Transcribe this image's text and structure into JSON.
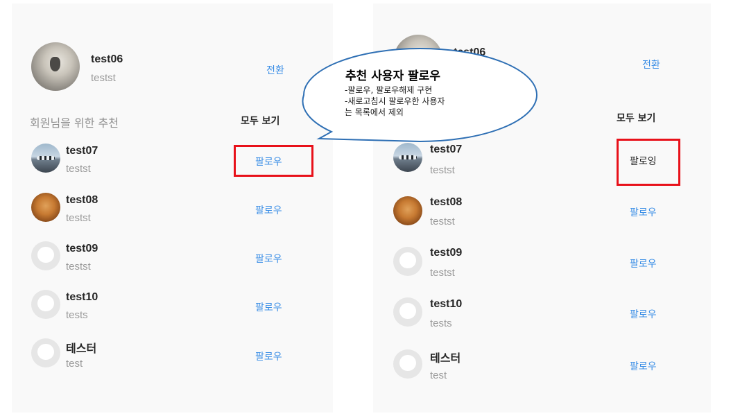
{
  "left": {
    "profile": {
      "username": "test06",
      "subtitle": "testst",
      "switch_label": "전환"
    },
    "section_title": "회원님을 위한 추천",
    "see_all": "모두 보기",
    "suggestions": [
      {
        "username": "test07",
        "subtitle": "testst",
        "action": "팔로우",
        "avatar": "birds-photo"
      },
      {
        "username": "test08",
        "subtitle": "testst",
        "action": "팔로우",
        "avatar": "dog-photo"
      },
      {
        "username": "test09",
        "subtitle": "testst",
        "action": "팔로우",
        "avatar": "default-avatar"
      },
      {
        "username": "test10",
        "subtitle": "tests",
        "action": "팔로우",
        "avatar": "default-avatar"
      },
      {
        "username": "테스터",
        "subtitle": "test",
        "action": "팔로우",
        "avatar": "default-avatar"
      }
    ]
  },
  "right": {
    "profile": {
      "username": "test06",
      "switch_label": "전환"
    },
    "see_all": "모두 보기",
    "suggestions": [
      {
        "username": "test07",
        "subtitle": "testst",
        "action": "팔로잉",
        "avatar": "birds-photo"
      },
      {
        "username": "test08",
        "subtitle": "testst",
        "action": "팔로우",
        "avatar": "dog-photo"
      },
      {
        "username": "test09",
        "subtitle": "testst",
        "action": "팔로우",
        "avatar": "default-avatar"
      },
      {
        "username": "test10",
        "subtitle": "tests",
        "action": "팔로우",
        "avatar": "default-avatar"
      },
      {
        "username": "테스터",
        "subtitle": "test",
        "action": "팔로우",
        "avatar": "default-avatar"
      }
    ]
  },
  "callout": {
    "title": "추천 사용자 팔로우",
    "lines": [
      "-팔로우, 팔로우해제 구현",
      "-새로고침시 팔로우한 사용자",
      "는 목록에서 제외"
    ]
  },
  "colors": {
    "link_blue": "#3a8ee6",
    "highlight_red": "#e8111a",
    "callout_border": "#2e6fb4",
    "panel_bg": "#f9f9f9"
  }
}
